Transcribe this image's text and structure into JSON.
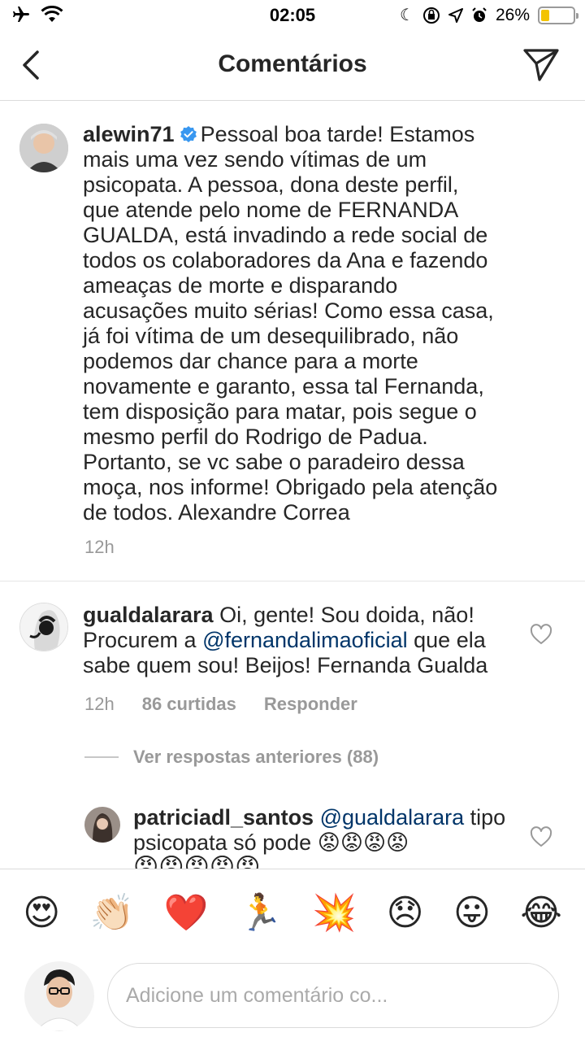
{
  "status_bar": {
    "time": "02:05",
    "battery_percent": "26%",
    "battery_level": 0.26,
    "icons": [
      "airplane-icon",
      "wifi-icon",
      "moon-icon",
      "orientation-lock-icon",
      "location-icon",
      "alarm-icon",
      "battery-icon"
    ]
  },
  "header": {
    "title": "Comentários",
    "back_icon": "chevron-left-icon",
    "direct_icon": "paper-plane-icon"
  },
  "caption": {
    "username": "alewin71",
    "verified": true,
    "text": "Pessoal boa tarde! Estamos mais uma vez sendo vítimas de um psicopata. A pessoa, dona deste perfil, que atende pelo nome de FERNANDA GUALDA, está invadindo a rede social de todos os colaboradores da Ana e fazendo ameaças de morte e disparando acusações muito sérias! Como essa casa, já foi vítima de um desequilibrado, não podemos dar chance para a morte novamente e garanto, essa tal Fernanda, tem disposição para matar, pois segue o mesmo perfil do Rodrigo de Padua. Portanto, se vc sabe o paradeiro dessa moça, nos informe! Obrigado pela atenção de todos. Alexandre Correa",
    "time": "12h"
  },
  "comment": {
    "username": "gualdalarara",
    "text_before": "Oi, gente! Sou doida, não! Procurem a",
    "mention": "@fernandalimaoficial",
    "text_after": "que ela sabe quem sou! Beijos! Fernanda Gualda",
    "time": "12h",
    "likes": "86 curtidas",
    "reply_label": "Responder"
  },
  "view_previous": "Ver respostas anteriores (88)",
  "reply": {
    "username": "patriciadl_santos",
    "mention": "@gualdalarara",
    "text": "tipo psicopata só pode",
    "emojis": "😡😡😡😡",
    "emojis_overflow": "😡😡😡😡😡"
  },
  "emoji_bar": [
    "😍",
    "👏🏻",
    "❤️",
    "🏃",
    "💥",
    "😞",
    "😛",
    "😂"
  ],
  "composer": {
    "placeholder": "Adicione um comentário co..."
  }
}
